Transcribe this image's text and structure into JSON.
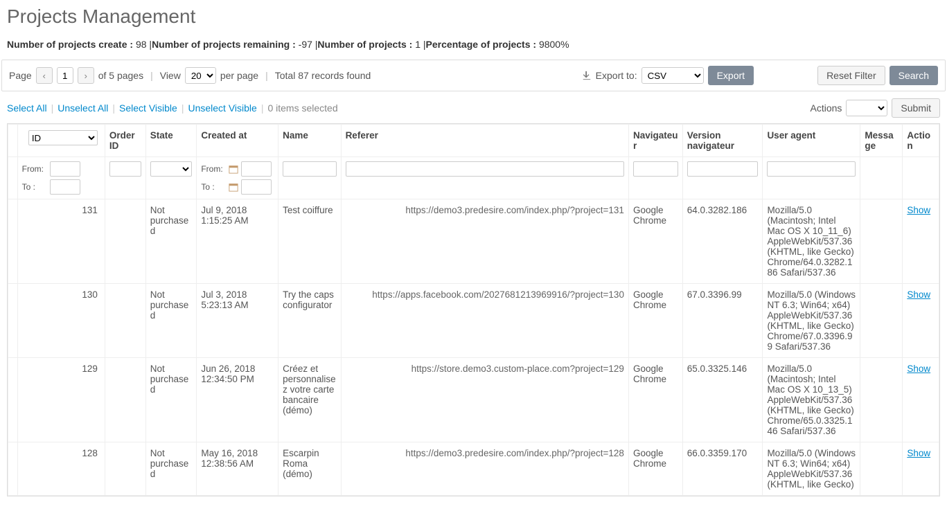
{
  "title": "Projects Management",
  "stats": {
    "created_label": "Number of projects create :",
    "created_value": "98",
    "remaining_label": "Number of projects remaining :",
    "remaining_value": "-97",
    "count_label": "Number of projects :",
    "count_value": "1",
    "percentage_label": "Percentage of projects :",
    "percentage_value": "9800%"
  },
  "toolbar": {
    "page_label": "Page",
    "page_value": "1",
    "pages_text": "of 5 pages",
    "view_label": "View",
    "per_page_label": "per page",
    "per_page_value": "20",
    "total_text": "Total 87 records found",
    "export_to_label": "Export to:",
    "export_format": "CSV",
    "export_btn": "Export",
    "reset_filter_btn": "Reset Filter",
    "search_btn": "Search"
  },
  "selection": {
    "select_all": "Select All",
    "unselect_all": "Unselect All",
    "select_visible": "Select Visible",
    "unselect_visible": "Unselect Visible",
    "items_selected": "0 items selected",
    "actions_label": "Actions",
    "submit_btn": "Submit"
  },
  "columns": {
    "id": "ID",
    "order_id": "Order ID",
    "state": "State",
    "created_at": "Created at",
    "name": "Name",
    "referer": "Referer",
    "navigator": "Navigateur",
    "version": "Version navigateur",
    "user_agent": "User agent",
    "message": "Message",
    "action": "Action"
  },
  "filter": {
    "from": "From:",
    "to": "To :"
  },
  "rows": [
    {
      "id": "131",
      "state": "Not purchased",
      "created": "Jul 9, 2018 1:15:25 AM",
      "name": "Test coiffure",
      "referer": "https://demo3.predesire.com/index.php/?project=131",
      "navigator": "Google Chrome",
      "version": "64.0.3282.186",
      "user_agent": "Mozilla/5.0 (Macintosh; Intel Mac OS X 10_11_6) AppleWebKit/537.36 (KHTML, like Gecko) Chrome/64.0.3282.186 Safari/537.36",
      "action": "Show"
    },
    {
      "id": "130",
      "state": "Not purchased",
      "created": "Jul 3, 2018 5:23:13 AM",
      "name": "Try the caps configurator",
      "referer": "https://apps.facebook.com/2027681213969916/?project=130",
      "navigator": "Google Chrome",
      "version": "67.0.3396.99",
      "user_agent": "Mozilla/5.0 (Windows NT 6.3; Win64; x64) AppleWebKit/537.36 (KHTML, like Gecko) Chrome/67.0.3396.99 Safari/537.36",
      "action": "Show"
    },
    {
      "id": "129",
      "state": "Not purchased",
      "created": "Jun 26, 2018 12:34:50 PM",
      "name": "Créez et personnalisez votre carte bancaire (démo)",
      "referer": "https://store.demo3.custom-place.com?project=129",
      "navigator": "Google Chrome",
      "version": "65.0.3325.146",
      "user_agent": "Mozilla/5.0 (Macintosh; Intel Mac OS X 10_13_5) AppleWebKit/537.36 (KHTML, like Gecko) Chrome/65.0.3325.146 Safari/537.36",
      "action": "Show"
    },
    {
      "id": "128",
      "state": "Not purchased",
      "created": "May 16, 2018 12:38:56 AM",
      "name": "Escarpin Roma (démo)",
      "referer": "https://demo3.predesire.com/index.php/?project=128",
      "navigator": "Google Chrome",
      "version": "66.0.3359.170",
      "user_agent": "Mozilla/5.0 (Windows NT 6.3; Win64; x64) AppleWebKit/537.36 (KHTML, like Gecko)",
      "action": "Show"
    }
  ]
}
